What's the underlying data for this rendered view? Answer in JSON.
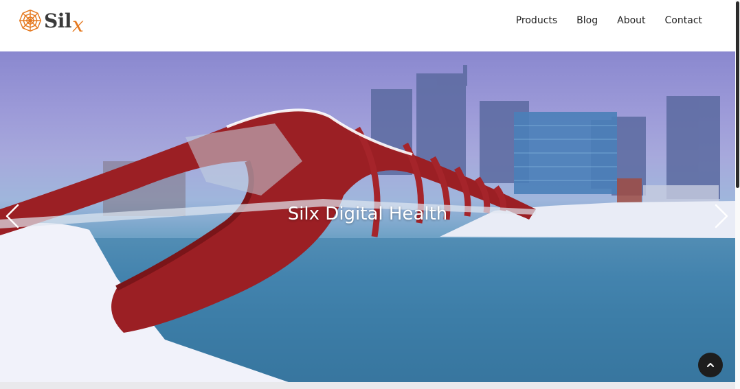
{
  "brand": {
    "name": "Sil",
    "name_accent": "x",
    "logo_icon": "spiderweb-icon",
    "accent_color": "#e5781e"
  },
  "nav": {
    "items": [
      {
        "label": "Products"
      },
      {
        "label": "Blog"
      },
      {
        "label": "About"
      },
      {
        "label": "Contact"
      }
    ]
  },
  "hero": {
    "title": "Silx Digital Health",
    "prev_icon": "chevron-left-icon",
    "next_icon": "chevron-right-icon"
  },
  "scroll_top": {
    "icon": "chevron-up-icon",
    "color": "#1d1d1d"
  }
}
